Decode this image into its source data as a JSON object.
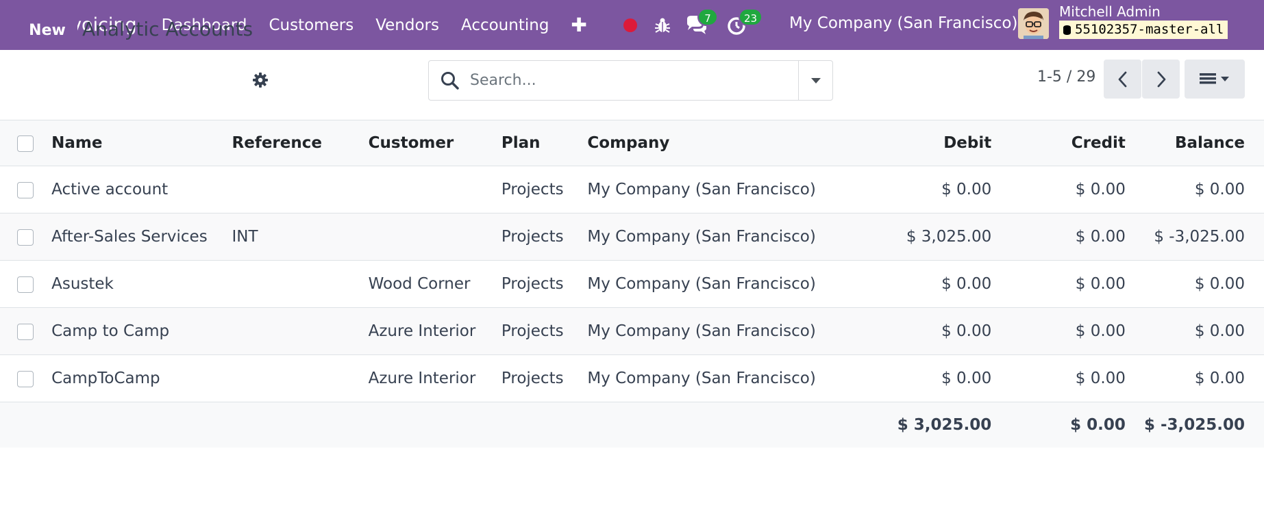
{
  "navbar": {
    "app_name": "Invoicing",
    "menu": [
      "Dashboard",
      "Customers",
      "Vendors",
      "Accounting"
    ],
    "plus": "✚",
    "messages_count": "7",
    "activities_count": "23",
    "company": "My Company (San Francisco)",
    "user_name": "Mitchell Admin",
    "database": "55102357-master-all",
    "colors": {
      "brand": "#7c56a0",
      "badge": "#20a83f",
      "record": "#dc1a3a"
    }
  },
  "control": {
    "new_label": "New",
    "title": "Analytic Accounts",
    "search_placeholder": "Search...",
    "pager": "1-5 / 29"
  },
  "table": {
    "headers": {
      "name": "Name",
      "reference": "Reference",
      "customer": "Customer",
      "plan": "Plan",
      "company": "Company",
      "debit": "Debit",
      "credit": "Credit",
      "balance": "Balance"
    },
    "rows": [
      {
        "name": "Active account",
        "reference": "",
        "customer": "",
        "plan": "Projects",
        "company": "My Company (San Francisco)",
        "debit": "$ 0.00",
        "credit": "$ 0.00",
        "balance": "$ 0.00"
      },
      {
        "name": "After-Sales Services",
        "reference": "INT",
        "customer": "",
        "plan": "Projects",
        "company": "My Company (San Francisco)",
        "debit": "$ 3,025.00",
        "credit": "$ 0.00",
        "balance": "$ -3,025.00"
      },
      {
        "name": "Asustek",
        "reference": "",
        "customer": "Wood Corner",
        "plan": "Projects",
        "company": "My Company (San Francisco)",
        "debit": "$ 0.00",
        "credit": "$ 0.00",
        "balance": "$ 0.00"
      },
      {
        "name": "Camp to Camp",
        "reference": "",
        "customer": "Azure Interior",
        "plan": "Projects",
        "company": "My Company (San Francisco)",
        "debit": "$ 0.00",
        "credit": "$ 0.00",
        "balance": "$ 0.00"
      },
      {
        "name": "CampToCamp",
        "reference": "",
        "customer": "Azure Interior",
        "plan": "Projects",
        "company": "My Company (San Francisco)",
        "debit": "$ 0.00",
        "credit": "$ 0.00",
        "balance": "$ 0.00"
      }
    ],
    "totals": {
      "debit": "$ 3,025.00",
      "credit": "$ 0.00",
      "balance": "$ -3,025.00"
    }
  }
}
